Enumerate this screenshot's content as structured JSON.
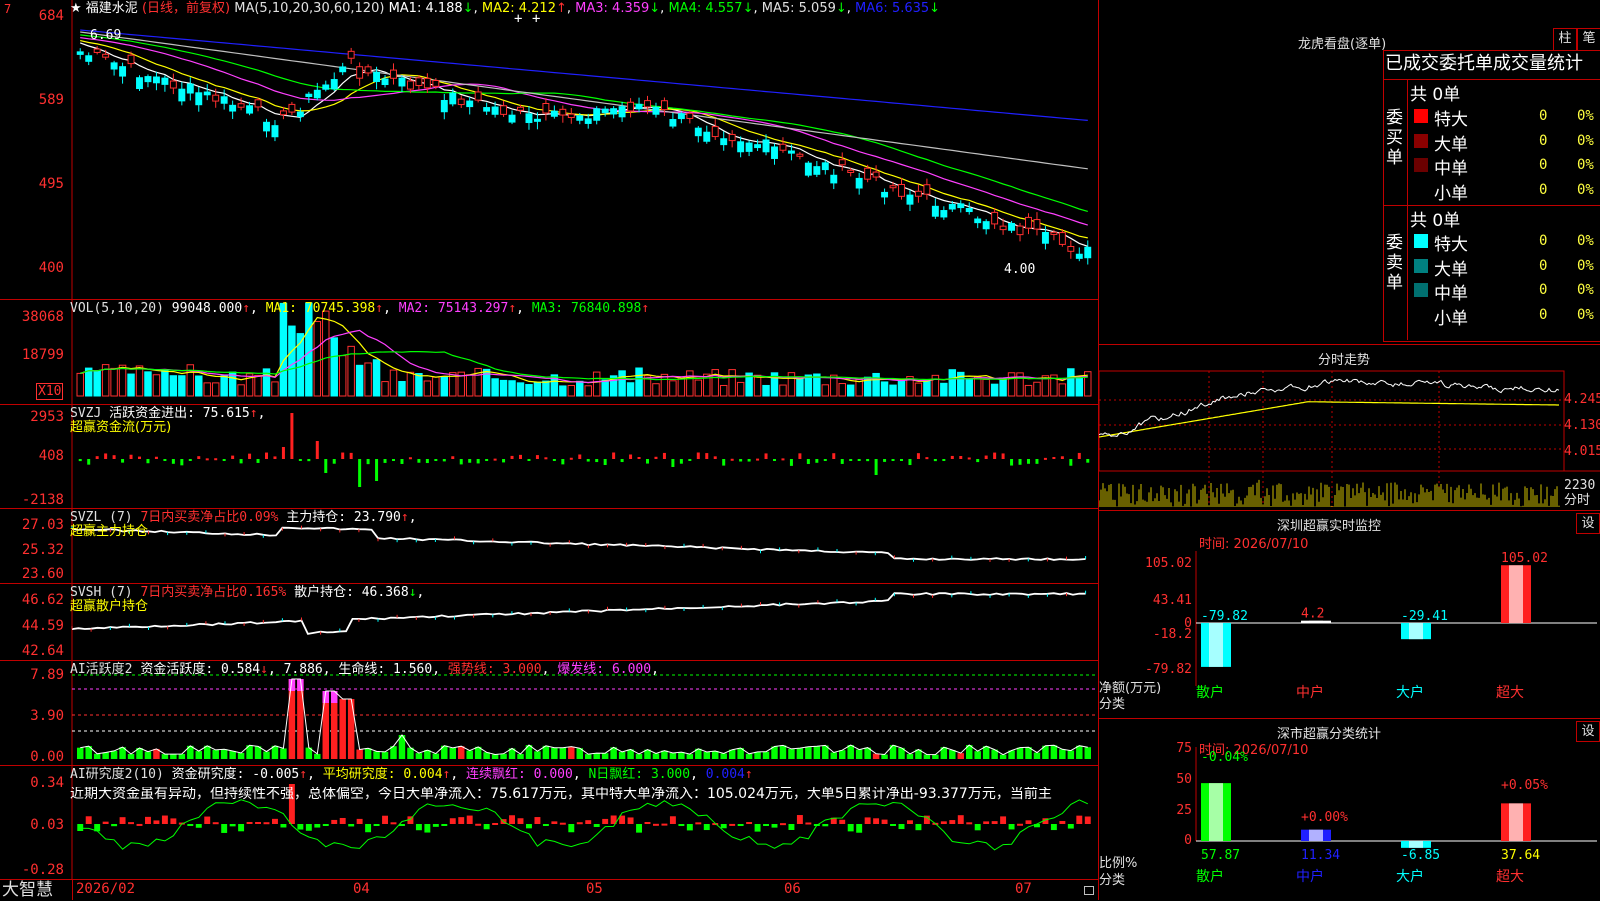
{
  "colors": {
    "up": "#ff3030",
    "down": "#00ffff",
    "vol_up": "#ff3030",
    "vol_down": "#00ffff",
    "ma1": "#ffffff",
    "ma2": "#ffff00",
    "ma3": "#ff40ff",
    "ma4": "#00ff00",
    "ma5": "#c0c0c0",
    "ma6": "#2020ff",
    "grid_line": "#c00000"
  },
  "main_chart": {
    "star": "★",
    "stock_name": "福建水泥",
    "period": "(日线，前复权)",
    "ma_params": "MA(5,10,20,30,60,120)",
    "ma1": "MA1: 4.188",
    "ma1_arrow": "↓",
    "ma2": "MA2: 4.212",
    "ma2_arrow": "↑",
    "ma3": "MA3: 4.359",
    "ma3_arrow": "↓",
    "ma4": "MA4: 4.557",
    "ma4_arrow": "↓",
    "ma5": "MA5: 5.059",
    "ma5_arrow": "↓",
    "ma6": "MA6: 5.635",
    "ma6_arrow": "↓",
    "hi_label": "6.69",
    "lo_label": "4.00",
    "y_labels": [
      "684",
      "589",
      "495",
      "400"
    ],
    "arrows": [
      "+",
      "+"
    ]
  },
  "vol": {
    "title": "VOL(5,10,20)",
    "value": "99048.000",
    "arrow0": "↑",
    "ma1": "MA1: 70745.398",
    "ma1_arrow": "↑",
    "ma2": "MA2: 75143.297",
    "ma2_arrow": "↑",
    "ma3": "MA3: 76840.898",
    "ma3_arrow": "↑",
    "y_labels": [
      "38068",
      "18799"
    ],
    "unit": "X10"
  },
  "svzj": {
    "title": "SVZJ",
    "l1": "活跃资金进出: 75.615",
    "arrow": "↑",
    "comma": ",",
    "l2": "超赢资金流(万元)",
    "y_labels": [
      "2953",
      "408",
      "-2138"
    ]
  },
  "svzl": {
    "title": "SVZL (7)",
    "red": "7日内买卖净占比0.09%",
    "main": "主力持仓: 23.790",
    "arrow": "↑",
    "comma": ",",
    "sub": "超赢主力持仓",
    "y_labels": [
      "27.03",
      "25.32",
      "23.60"
    ]
  },
  "svsh": {
    "title": "SVSH (7)",
    "red": "7日内买卖净占比0.165%",
    "main": "散户持仓: 46.368",
    "arrow": "↓",
    "comma": ",",
    "sub": "超赢散户持仓",
    "y_labels": [
      "46.62",
      "44.59",
      "42.64"
    ]
  },
  "ai1": {
    "title": "AI活跃度2",
    "a": "资金活跃度: 0.584",
    "a_arrow": "↓",
    "b": "7.886",
    "c": "生命线: 1.560",
    "d": "强势线: 3.000",
    "e": "爆发线: 6.000",
    "y_labels": [
      "7.89",
      "3.90",
      "0.00"
    ]
  },
  "ai2": {
    "title": "AI研究度2(10)",
    "a": "资金研究度: -0.005",
    "a_arrow": "↑",
    "b": "平均研究度: 0.004",
    "b_arrow": "↑",
    "c": "连续飘红: 0.000",
    "d": "N日飘红: 3.000",
    "e": "0.004",
    "e_arrow": "↑",
    "comment": "近期大资金虽有异动，但持续性不强，总体偏空，今日大单净流入：75.617万元，其中特大单净流入：105.024万元，大单5日累计净出-93.377万元，当前主",
    "y_labels": [
      "0.34",
      "0.03",
      "-0.28"
    ]
  },
  "xaxis": {
    "labels": [
      "2026/02",
      "04",
      "05",
      "06",
      "07"
    ],
    "brand": "大智慧"
  },
  "dragon": {
    "title": "龙虎看盘(逐单)",
    "btn1": "柱",
    "btn2": "笔",
    "header": "已成交委托单成交量统计",
    "buy_side": "委买单",
    "sell_side": "委卖单",
    "buy_total": "共 0单",
    "sell_total": "共 0单",
    "rows": [
      "特大",
      "大单",
      "中单",
      "小单"
    ],
    "zero": "0",
    "pct": "0%",
    "buy_colors": [
      "#ff0000",
      "#8b0000",
      "#6b0000",
      "#000000"
    ],
    "sell_colors": [
      "#00ffff",
      "#008080",
      "#007070",
      "#000000"
    ]
  },
  "fenshi": {
    "title": "分时走势",
    "y_labels": [
      "4.245",
      "4.130",
      "4.015"
    ],
    "vol_label": "2230",
    "vol_unit": "分时"
  },
  "monitor": {
    "title": "深圳超赢实时监控",
    "btn": "设",
    "time": "时间: 2026/07/10",
    "y_labels": [
      "105.02",
      "43.41",
      "0",
      "-18.2",
      "-79.82"
    ],
    "ylabel1": "净额(万元)",
    "ylabel2": "分类",
    "cats": [
      "散户",
      "中户",
      "大户",
      "超大"
    ],
    "values": [
      -79.82,
      4.2,
      -29.41,
      105.02
    ],
    "value_labels": [
      "-79.82",
      "4.2",
      "-29.41",
      "105.02"
    ]
  },
  "classify": {
    "title": "深市超赢分类统计",
    "btn": "设",
    "time": "时间: 2026/07/10",
    "y_labels": [
      "75",
      "50",
      "25",
      "0"
    ],
    "ylabel1": "比例%",
    "ylabel2": "分类",
    "cats": [
      "散户",
      "中户",
      "大户",
      "超大"
    ],
    "values": [
      57.87,
      11.34,
      -6.85,
      37.64
    ],
    "value_labels": [
      "57.87",
      "11.34",
      "-6.85",
      "37.64"
    ],
    "top_labels": [
      "-0.04%",
      "+0.00%",
      "",
      "+0.05%"
    ]
  }
}
